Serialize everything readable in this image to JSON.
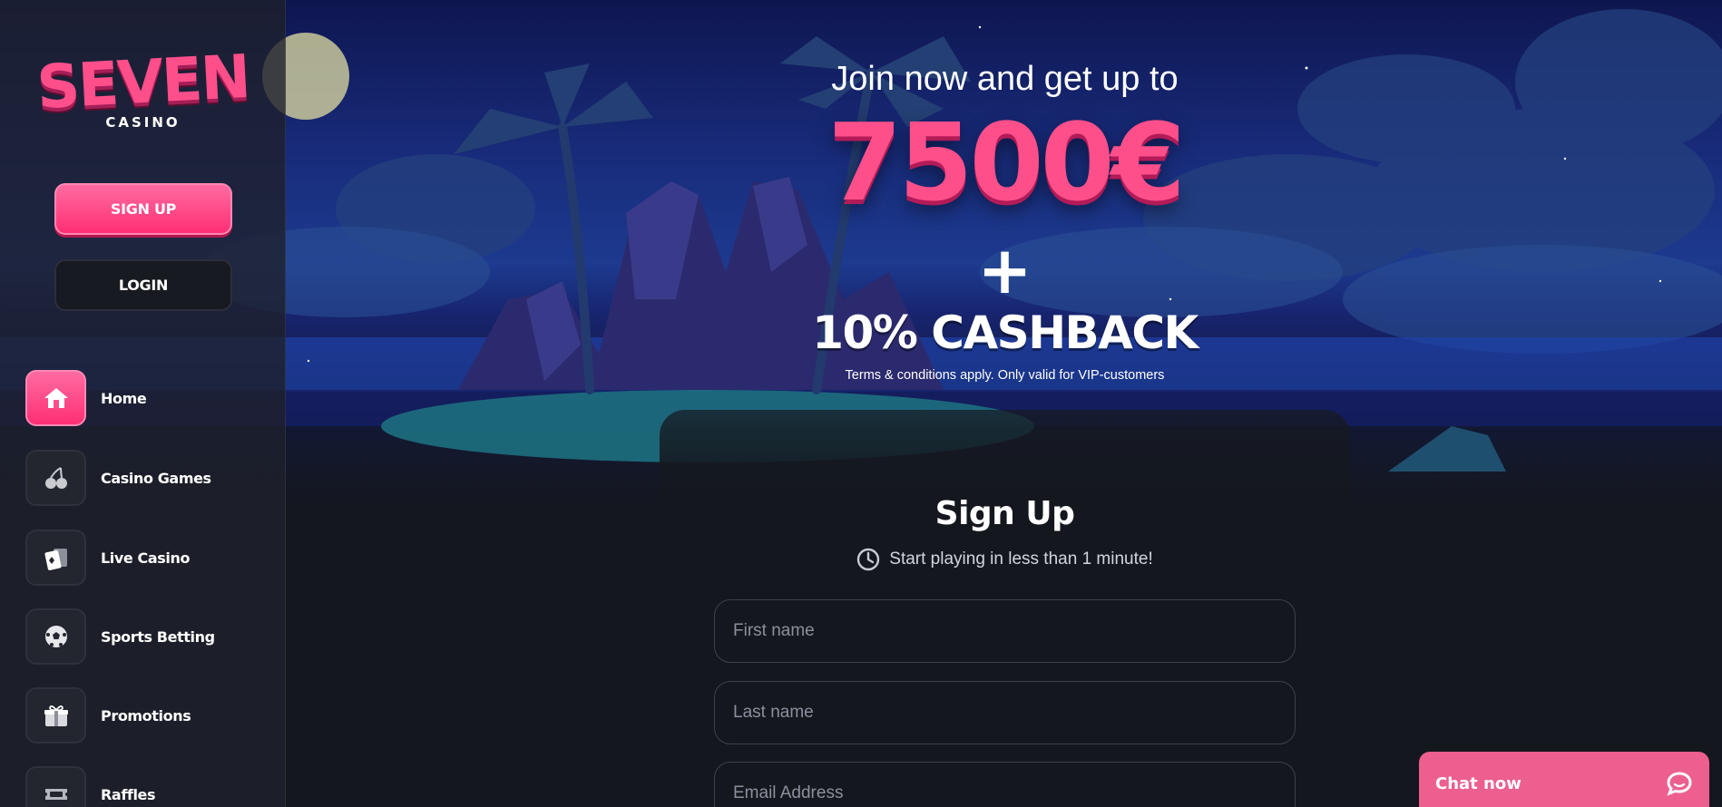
{
  "brand": {
    "logo_main": "SEVEN",
    "logo_sub": "CASINO"
  },
  "auth": {
    "signup_label": "SIGN UP",
    "login_label": "LOGIN"
  },
  "nav": {
    "items": [
      {
        "label": "Home",
        "icon": "home-icon",
        "active": true
      },
      {
        "label": "Casino Games",
        "icon": "cherries-icon",
        "active": false
      },
      {
        "label": "Live Casino",
        "icon": "playing-cards-icon",
        "active": false
      },
      {
        "label": "Sports Betting",
        "icon": "soccer-ball-icon",
        "active": false
      },
      {
        "label": "Promotions",
        "icon": "gift-icon",
        "active": false
      },
      {
        "label": "Raffles",
        "icon": "ticket-icon",
        "active": false
      }
    ]
  },
  "promo": {
    "headline": "Join now and get up to",
    "amount": "7500€",
    "plus": "+",
    "cashback": "10% CASHBACK",
    "terms": "Terms & conditions apply. Only valid for VIP-customers"
  },
  "signup_form": {
    "title": "Sign Up",
    "subtitle": "Start playing in less than 1 minute!",
    "subtitle_icon": "clock-icon",
    "fields": [
      {
        "placeholder": "First name",
        "value": ""
      },
      {
        "placeholder": "Last name",
        "value": ""
      },
      {
        "placeholder": "Email Address",
        "value": ""
      }
    ]
  },
  "chat": {
    "label": "Chat now",
    "icon": "chat-bubble-icon"
  },
  "colors": {
    "accent_pink": "#ff4f8b",
    "sidebar_bg": "#1e212c",
    "page_bg": "#14171e",
    "chat_bg": "#ec5f8e"
  }
}
